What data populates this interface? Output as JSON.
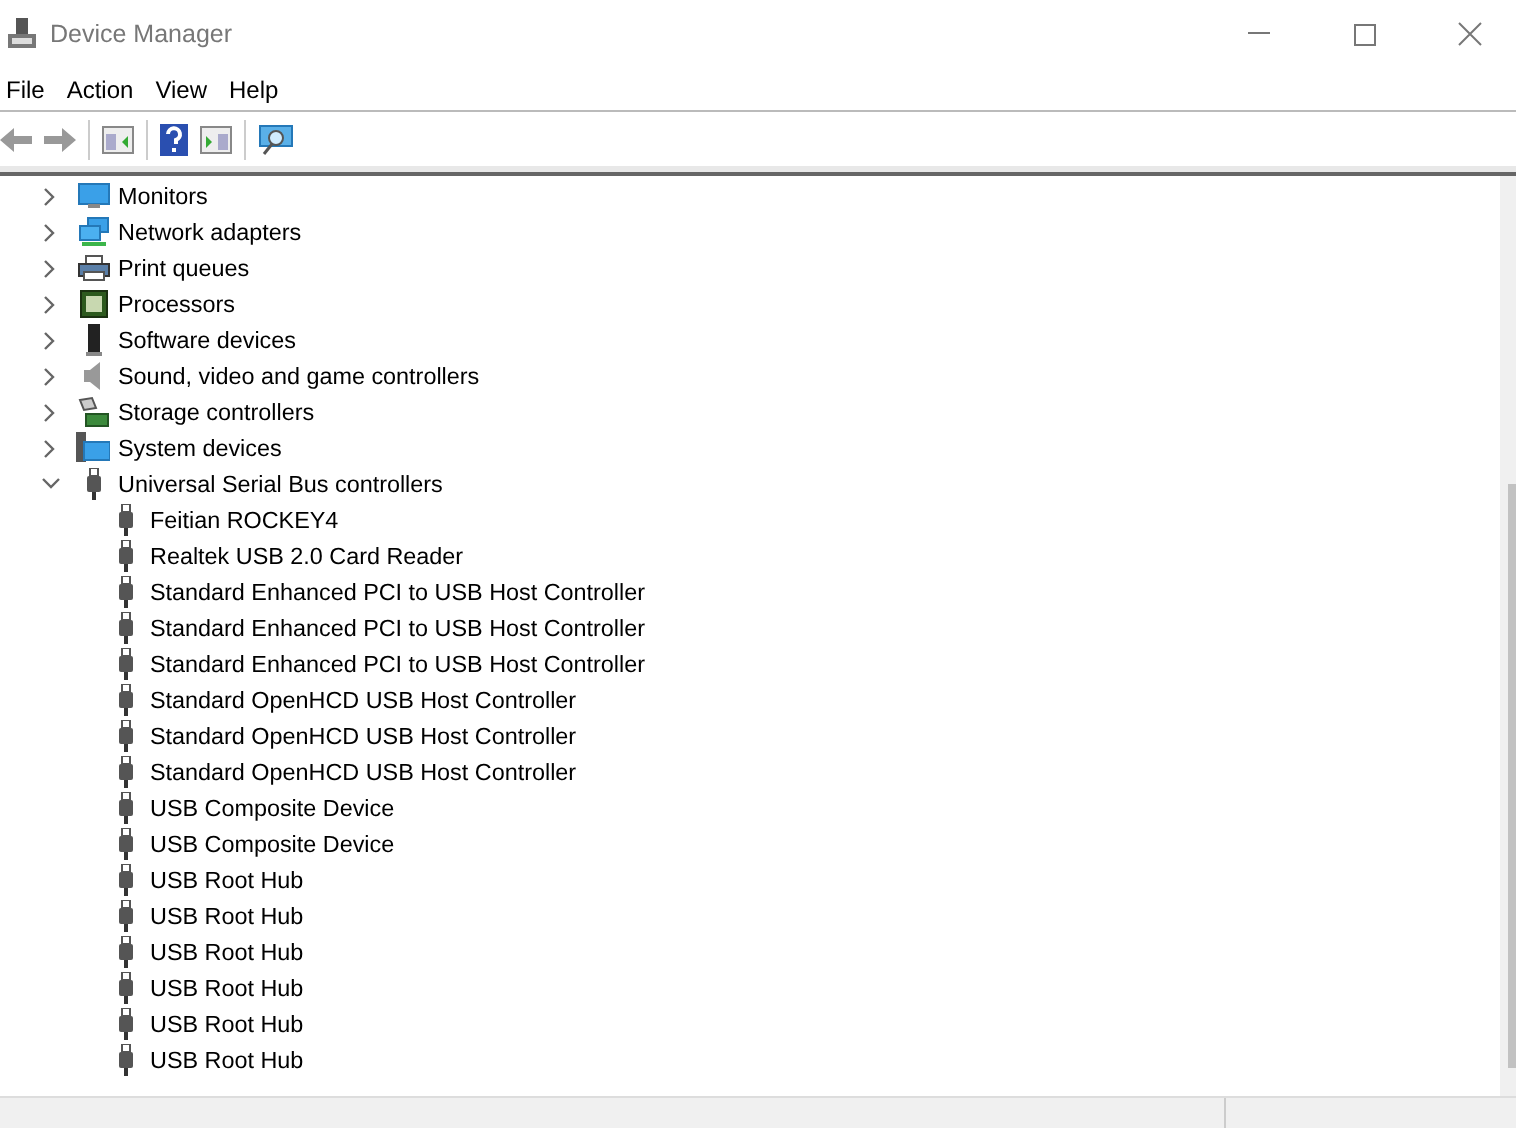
{
  "window": {
    "title": "Device Manager"
  },
  "menu": [
    "File",
    "Action",
    "View",
    "Help"
  ],
  "tree": [
    {
      "label": "Monitors",
      "kind": "monitor",
      "expanded": false
    },
    {
      "label": "Network adapters",
      "kind": "network",
      "expanded": false
    },
    {
      "label": "Print queues",
      "kind": "printer",
      "expanded": false
    },
    {
      "label": "Processors",
      "kind": "chip",
      "expanded": false
    },
    {
      "label": "Software devices",
      "kind": "software",
      "expanded": false
    },
    {
      "label": "Sound, video and game controllers",
      "kind": "speaker",
      "expanded": false
    },
    {
      "label": "Storage controllers",
      "kind": "storage",
      "expanded": false
    },
    {
      "label": "System devices",
      "kind": "system",
      "expanded": false
    },
    {
      "label": "Universal Serial Bus controllers",
      "kind": "usb",
      "expanded": true,
      "children": [
        {
          "label": "Feitian ROCKEY4",
          "kind": "usb"
        },
        {
          "label": "Realtek USB 2.0 Card Reader",
          "kind": "usb"
        },
        {
          "label": "Standard Enhanced PCI to USB Host Controller",
          "kind": "usb"
        },
        {
          "label": "Standard Enhanced PCI to USB Host Controller",
          "kind": "usb"
        },
        {
          "label": "Standard Enhanced PCI to USB Host Controller",
          "kind": "usb"
        },
        {
          "label": "Standard OpenHCD USB Host Controller",
          "kind": "usb"
        },
        {
          "label": "Standard OpenHCD USB Host Controller",
          "kind": "usb"
        },
        {
          "label": "Standard OpenHCD USB Host Controller",
          "kind": "usb"
        },
        {
          "label": "USB Composite Device",
          "kind": "usb"
        },
        {
          "label": "USB Composite Device",
          "kind": "usb"
        },
        {
          "label": "USB Root Hub",
          "kind": "usb"
        },
        {
          "label": "USB Root Hub",
          "kind": "usb"
        },
        {
          "label": "USB Root Hub",
          "kind": "usb"
        },
        {
          "label": "USB Root Hub",
          "kind": "usb"
        },
        {
          "label": "USB Root Hub",
          "kind": "usb"
        },
        {
          "label": "USB Root Hub",
          "kind": "usb"
        }
      ]
    }
  ]
}
